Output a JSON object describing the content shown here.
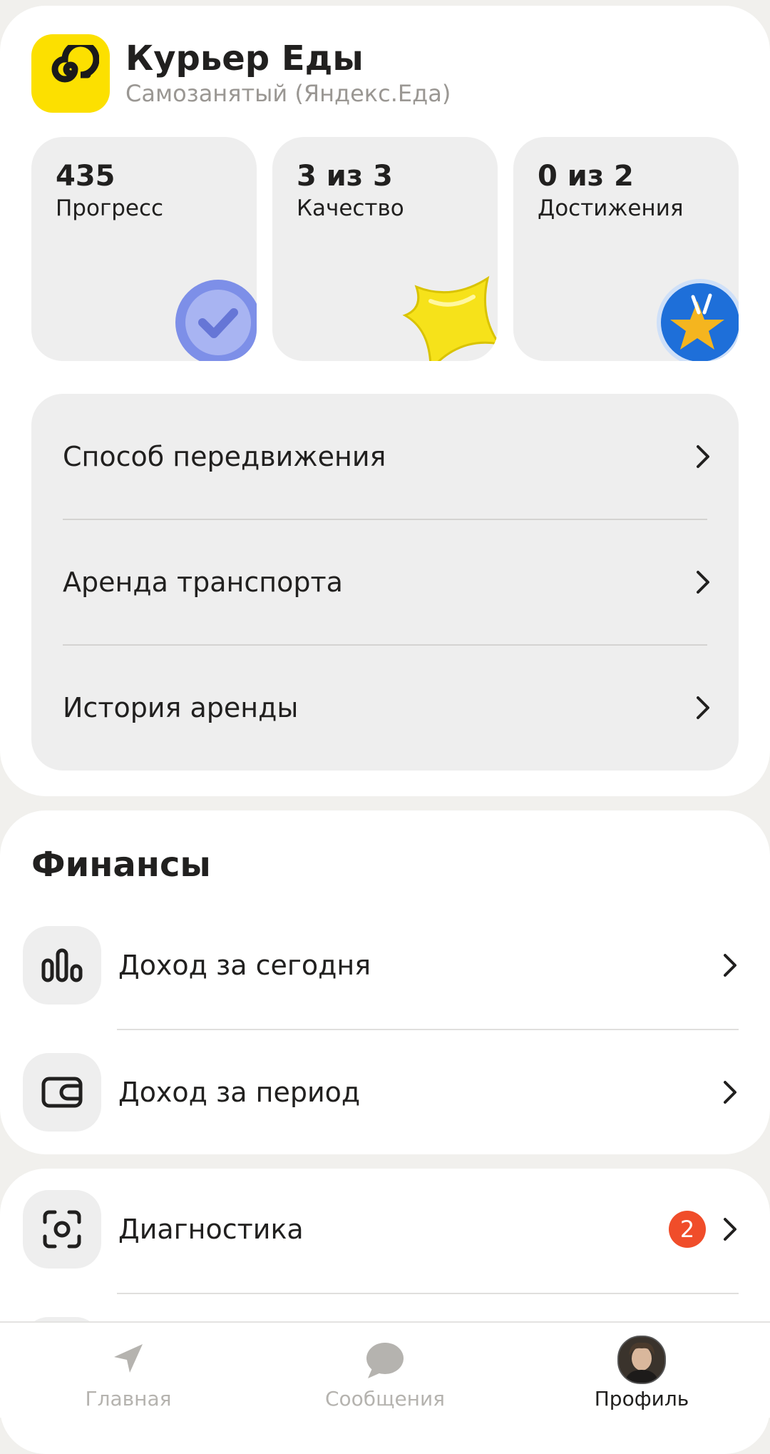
{
  "header": {
    "title": "Курьер Еды",
    "subtitle": "Самозанятый (Яндекс.Еда)"
  },
  "stats": [
    {
      "value": "435",
      "label": "Прогресс",
      "badge_icon": "check-medal-icon"
    },
    {
      "value": "3 из 3",
      "label": "Качество",
      "badge_icon": "yellow-star-medal-icon"
    },
    {
      "value": "0 из 2",
      "label": "Достижения",
      "badge_icon": "victory-star-medal-icon"
    }
  ],
  "transport_menu": [
    {
      "label": "Способ передвижения"
    },
    {
      "label": "Аренда транспорта"
    },
    {
      "label": "История аренды"
    }
  ],
  "finance": {
    "title": "Финансы",
    "items": [
      {
        "label": "Доход за сегодня",
        "icon": "bar-chart-icon"
      },
      {
        "label": "Доход за период",
        "icon": "wallet-icon"
      }
    ]
  },
  "diagnostics": {
    "label": "Диагностика",
    "icon": "camera-scan-icon",
    "badge_count": "2"
  },
  "tabbar": {
    "tabs": [
      {
        "label": "Главная",
        "icon": "navigation-arrow-icon",
        "active": false
      },
      {
        "label": "Сообщения",
        "icon": "chat-bubble-icon",
        "active": false
      },
      {
        "label": "Профиль",
        "icon": "avatar",
        "active": true
      }
    ]
  },
  "colors": {
    "brand_yellow": "#fce000",
    "badge_red": "#f04d2a",
    "text_primary": "#21201f",
    "text_secondary": "#9a9793"
  }
}
